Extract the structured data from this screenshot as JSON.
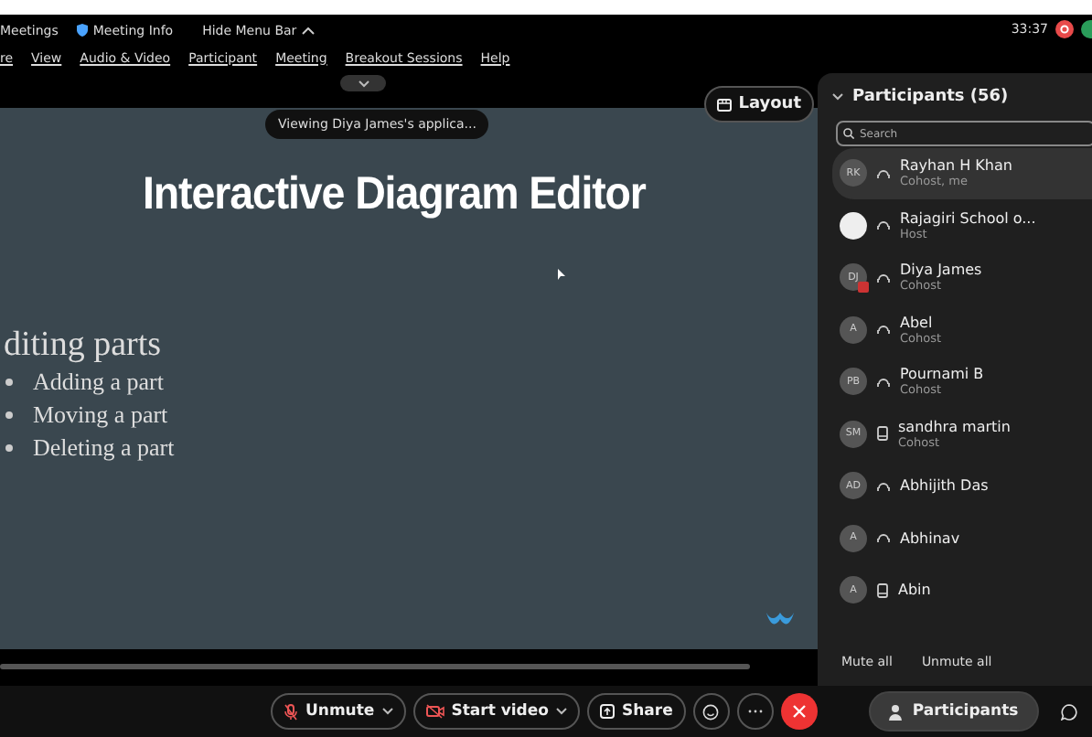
{
  "menu_bar": {
    "top_items": [
      "Meetings",
      "Meeting Info",
      "Hide Menu Bar"
    ],
    "menus": [
      "re",
      "View",
      "Audio & Video",
      "Participant",
      "Meeting",
      "Breakout Sessions",
      "Help"
    ],
    "timer": "33:37"
  },
  "stage": {
    "banner": "Viewing Diya James's applica...",
    "layout_button": "Layout",
    "slide": {
      "title": "Interactive Diagram Editor",
      "heading": "diting parts",
      "bullets": [
        "Adding a part",
        "Moving a part",
        "Deleting a part"
      ]
    }
  },
  "participants": {
    "title": "Participants (56)",
    "search": {
      "placeholder": "Search"
    },
    "items": [
      {
        "initials": "RK",
        "name": "Rayhan H Khan",
        "role": "Cohost, me",
        "kind": "audio",
        "selected": true,
        "video_off": false
      },
      {
        "name": "Rajagiri School o...",
        "role": "Host",
        "kind": "audio",
        "selected": false,
        "video_off": false
      },
      {
        "initials": "DJ",
        "name": "Diya James",
        "role": "Cohost",
        "kind": "audio",
        "selected": false,
        "video_off": true
      },
      {
        "initials": "A",
        "name": "Abel",
        "role": "Cohost",
        "kind": "audio",
        "selected": false,
        "video_off": false
      },
      {
        "initials": "PB",
        "name": "Pournami B",
        "role": "Cohost",
        "kind": "audio",
        "selected": false,
        "video_off": false
      },
      {
        "initials": "SM",
        "name": "sandhra martin",
        "role": "Cohost",
        "kind": "phone",
        "selected": false,
        "video_off": false
      },
      {
        "initials": "AD",
        "name": "Abhijith Das",
        "kind": "audio",
        "selected": false,
        "video_off": false
      },
      {
        "initials": "A",
        "name": "Abhinav",
        "kind": "audio",
        "selected": false,
        "video_off": false
      },
      {
        "initials": "A",
        "name": "Abin",
        "kind": "phone",
        "selected": false,
        "video_off": false
      }
    ],
    "actions": [
      "Mute all",
      "Unmute all"
    ]
  },
  "toolbar": {
    "unmute": "Unmute",
    "video": "Start video",
    "share": "Share",
    "participants": {
      "label": "Participants",
      "selected": true
    }
  }
}
